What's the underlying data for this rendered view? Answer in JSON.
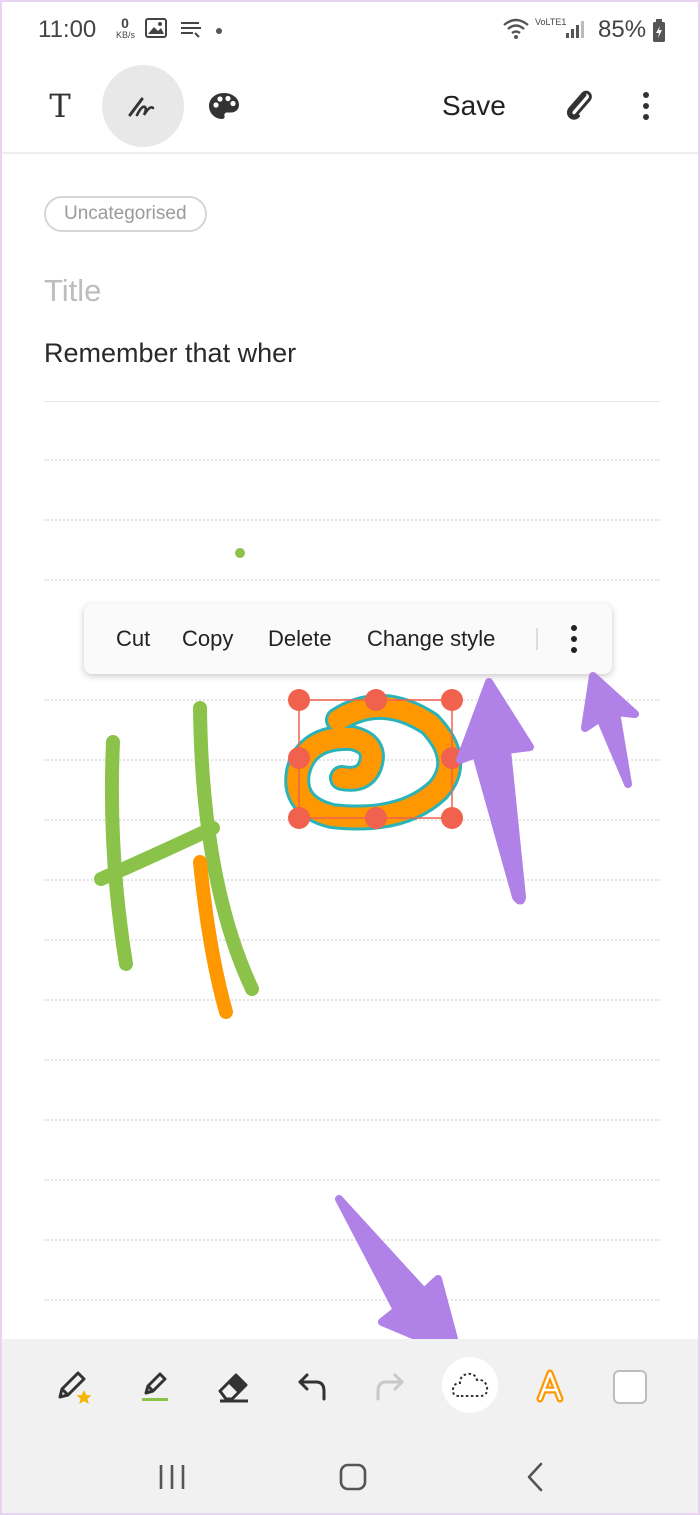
{
  "status_bar": {
    "time": "11:00",
    "speed_value": "0",
    "speed_unit": "KB/s",
    "network_label": "VoLTE1",
    "battery_text": "85%"
  },
  "toolbar": {
    "save_label": "Save"
  },
  "note": {
    "category": "Uncategorised",
    "title_placeholder": "Title",
    "body_text": "Remember that wher"
  },
  "context_menu": {
    "items": [
      {
        "label": "Cut"
      },
      {
        "label": "Copy"
      },
      {
        "label": "Delete"
      },
      {
        "label": "Change style"
      }
    ]
  },
  "colors": {
    "green_stroke": "#8bc34a",
    "orange_stroke": "#ff9800",
    "selection_handle": "#f0624d",
    "selection_outline": "#2ab3b8",
    "annotation_arrow": "#b081e6"
  },
  "icons": {
    "top_toolbar": [
      "text-mode-icon",
      "handwriting-pen-icon",
      "palette-icon",
      "attach-icon",
      "more-vert-icon"
    ],
    "bottom_toolbar": [
      "pen-favourite-icon",
      "pen-settings-icon",
      "eraser-icon",
      "undo-icon",
      "redo-icon",
      "lasso-select-icon",
      "text-style-icon",
      "color-swatch-icon"
    ],
    "nav": [
      "recent-apps-icon",
      "home-icon",
      "back-icon"
    ]
  }
}
